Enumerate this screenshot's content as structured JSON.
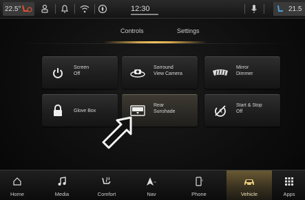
{
  "status_bar": {
    "driver_temp": "22.5°",
    "passenger_temp": "21.5",
    "clock": "12:30"
  },
  "tabs": [
    {
      "label": "Controls",
      "active": true
    },
    {
      "label": "Settings",
      "active": false
    }
  ],
  "controls": [
    {
      "line1": "Screen",
      "line2": "Off",
      "icon": "power-icon"
    },
    {
      "line1": "Sorround",
      "line2": "View Camera",
      "icon": "surround-camera-icon"
    },
    {
      "line1": "Mirror",
      "line2": "Dimmer",
      "icon": "mirror-dimmer-icon"
    },
    {
      "line1": "Glove Box",
      "line2": "",
      "icon": "lock-icon"
    },
    {
      "line1": "Rear",
      "line2": "Sunshade",
      "icon": "sunshade-icon"
    },
    {
      "line1": "Start & Stop",
      "line2": "Off",
      "icon": "start-stop-icon"
    }
  ],
  "nav": [
    {
      "label": "Home",
      "icon": "home-icon"
    },
    {
      "label": "Media",
      "icon": "music-note-icon"
    },
    {
      "label": "Comfort",
      "icon": "heated-seat-icon"
    },
    {
      "label": "Nav",
      "icon": "navigation-arrow-icon"
    },
    {
      "label": "Phone",
      "icon": "phone-icon"
    },
    {
      "label": "Vehicle",
      "icon": "car-icon",
      "active": true
    },
    {
      "label": "Apps",
      "icon": "apps-grid-icon"
    }
  ],
  "colors": {
    "accent": "#d9a94c",
    "active_tile": "#3e3a32",
    "background": "#0d0d0d"
  }
}
